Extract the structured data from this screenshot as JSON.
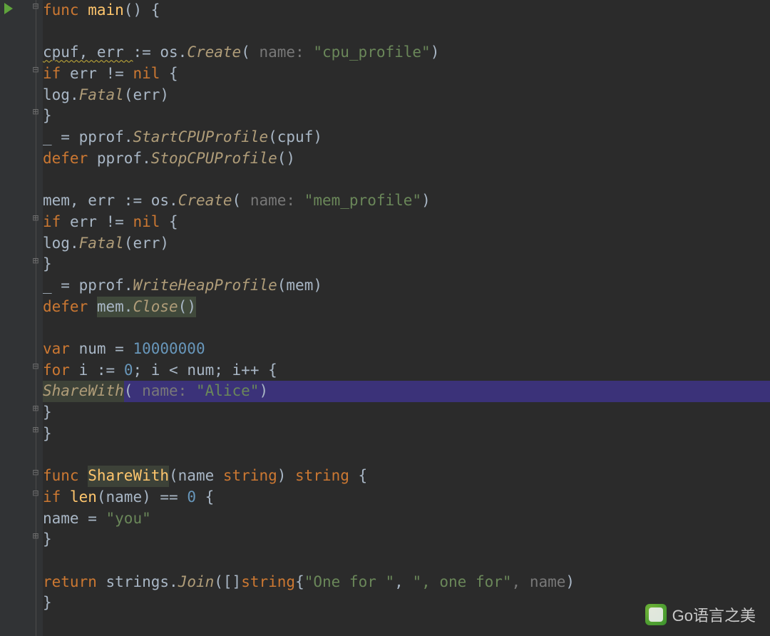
{
  "watermark": "Go语言之美",
  "code": {
    "L1": {
      "kw1": "func ",
      "fn": "main",
      "tail": "() {"
    },
    "L3": {
      "lhs": "cpuf, err ",
      "assign": ":= ",
      "pkg": "os",
      "dot": ".",
      "call": "Create",
      "open": "( ",
      "hint": "name: ",
      "str": "\"cpu_profile\"",
      "close": ")"
    },
    "L4": {
      "kw": "if ",
      "cond": "err != ",
      "nil": "nil ",
      "brace": "{"
    },
    "L5": {
      "obj": "log",
      "dot": ".",
      "call": "Fatal",
      "args": "(err)"
    },
    "L6": {
      "brace": "}"
    },
    "L7": {
      "us": "_ ",
      "eq": "= ",
      "pkg": "pprof",
      "dot": ".",
      "call": "StartCPUProfile",
      "args": "(cpuf)"
    },
    "L8": {
      "kw": "defer ",
      "pkg": "pprof",
      "dot": ".",
      "call": "StopCPUProfile",
      "args": "()"
    },
    "L10": {
      "lhs": "mem, err ",
      "assign": ":= ",
      "pkg": "os",
      "dot": ".",
      "call": "Create",
      "open": "( ",
      "hint": "name: ",
      "str": "\"mem_profile\"",
      "close": ")"
    },
    "L11": {
      "kw": "if ",
      "cond": "err != ",
      "nil": "nil ",
      "brace": "{"
    },
    "L12": {
      "obj": "log",
      "dot": ".",
      "call": "Fatal",
      "args": "(err)"
    },
    "L13": {
      "brace": "}"
    },
    "L14": {
      "us": "_ ",
      "eq": "= ",
      "pkg": "pprof",
      "dot": ".",
      "call": "WriteHeapProfile",
      "args": "(mem)"
    },
    "L15": {
      "kw": "defer ",
      "obj": "mem",
      "dot": ".",
      "call": "Close",
      "args": "()"
    },
    "L17": {
      "kw": "var ",
      "name": "num ",
      "eq": "= ",
      "val": "10000000"
    },
    "L18": {
      "kw1": "for ",
      "v": "i ",
      "assign": ":= ",
      "zero": "0",
      "sep": "; i < num; i++ {",
      "semi": ""
    },
    "L19": {
      "fn": "ShareWith",
      "open": "( ",
      "hint": "name: ",
      "str": "\"Alice\"",
      "close": ")"
    },
    "L20": {
      "brace": "}"
    },
    "L21": {
      "brace": "}"
    },
    "L23": {
      "kw": "func ",
      "fn": "ShareWith",
      "sig": "(name ",
      "type": "string",
      "mid": ") ",
      "ret": "string",
      "tail": " {"
    },
    "L24": {
      "kw": "if ",
      "call": "len",
      "args": "(name) == ",
      "zero": "0",
      "brace": " {"
    },
    "L25": {
      "name": "name ",
      "eq": "= ",
      "str": "\"you\""
    },
    "L26": {
      "brace": "}"
    },
    "L28": {
      "kw": "return ",
      "pkg": "strings",
      "dot": ".",
      "call": "Join",
      "open": "([]",
      "type": "string",
      "brace": "{",
      "str1": "\"One for \"",
      "comma": ", ",
      "str2": "\", one for\"",
      "hint": ", name",
      "tail": ")"
    },
    "L29": {
      "brace": "}"
    }
  }
}
